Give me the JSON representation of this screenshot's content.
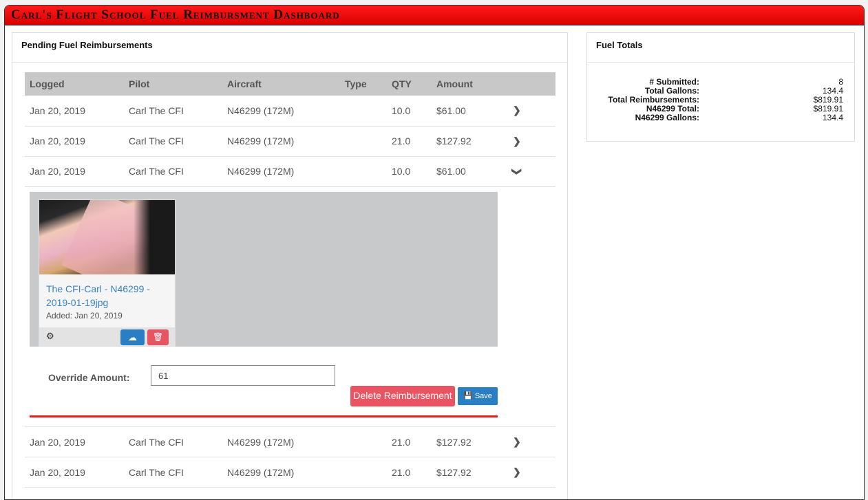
{
  "app": {
    "title": "Carl's Flight School Fuel Reimbursment Dashboard"
  },
  "pending": {
    "title": "Pending Fuel Reimbursements",
    "columns": [
      "Logged",
      "Pilot",
      "Aircraft",
      "Type",
      "QTY",
      "Amount"
    ],
    "rows": [
      {
        "logged": "Jan 20, 2019",
        "pilot": "Carl The CFI",
        "aircraft": "N46299 (172M)",
        "type": "",
        "qty": "10.0",
        "amount": "$61.00",
        "icon": "chevron-right-icon"
      },
      {
        "logged": "Jan 20, 2019",
        "pilot": "Carl The CFI",
        "aircraft": "N46299 (172M)",
        "type": "",
        "qty": "21.0",
        "amount": "$127.92",
        "icon": "chevron-right-icon"
      },
      {
        "logged": "Jan 20, 2019",
        "pilot": "Carl The CFI",
        "aircraft": "N46299 (172M)",
        "type": "",
        "qty": "10.0",
        "amount": "$61.00",
        "icon": "chevron-down-icon"
      }
    ],
    "expanded": {
      "attachment": {
        "filename": "The CFI-Carl - N46299 - 2019-01-19jpg",
        "added": "Added: Jan 20, 2019"
      },
      "override_label": "Override Amount:",
      "override_value": "61",
      "delete_label": "Delete Reimbursement",
      "save_label": "Save"
    },
    "more_rows": [
      {
        "logged": "Jan 20, 2019",
        "pilot": "Carl The CFI",
        "aircraft": "N46299 (172M)",
        "type": "",
        "qty": "21.0",
        "amount": "$127.92",
        "icon": "chevron-right-icon"
      },
      {
        "logged": "Jan 20, 2019",
        "pilot": "Carl The CFI",
        "aircraft": "N46299 (172M)",
        "type": "",
        "qty": "21.0",
        "amount": "$127.92",
        "icon": "chevron-right-icon"
      }
    ]
  },
  "totals": {
    "title": "Fuel Totals",
    "items": [
      {
        "label": "# Submitted:",
        "value": "8"
      },
      {
        "label": "Total Gallons:",
        "value": "134.4"
      },
      {
        "label": "Total Reimbursements:",
        "value": "$819.91"
      },
      {
        "label": "N46299 Total:",
        "value": "$819.91"
      },
      {
        "label": "N46299 Gallons:",
        "value": "134.4"
      }
    ]
  },
  "colors": {
    "header": "#e50000",
    "primary": "#2a7fc4",
    "danger": "#e95462",
    "rule": "#e02020"
  }
}
